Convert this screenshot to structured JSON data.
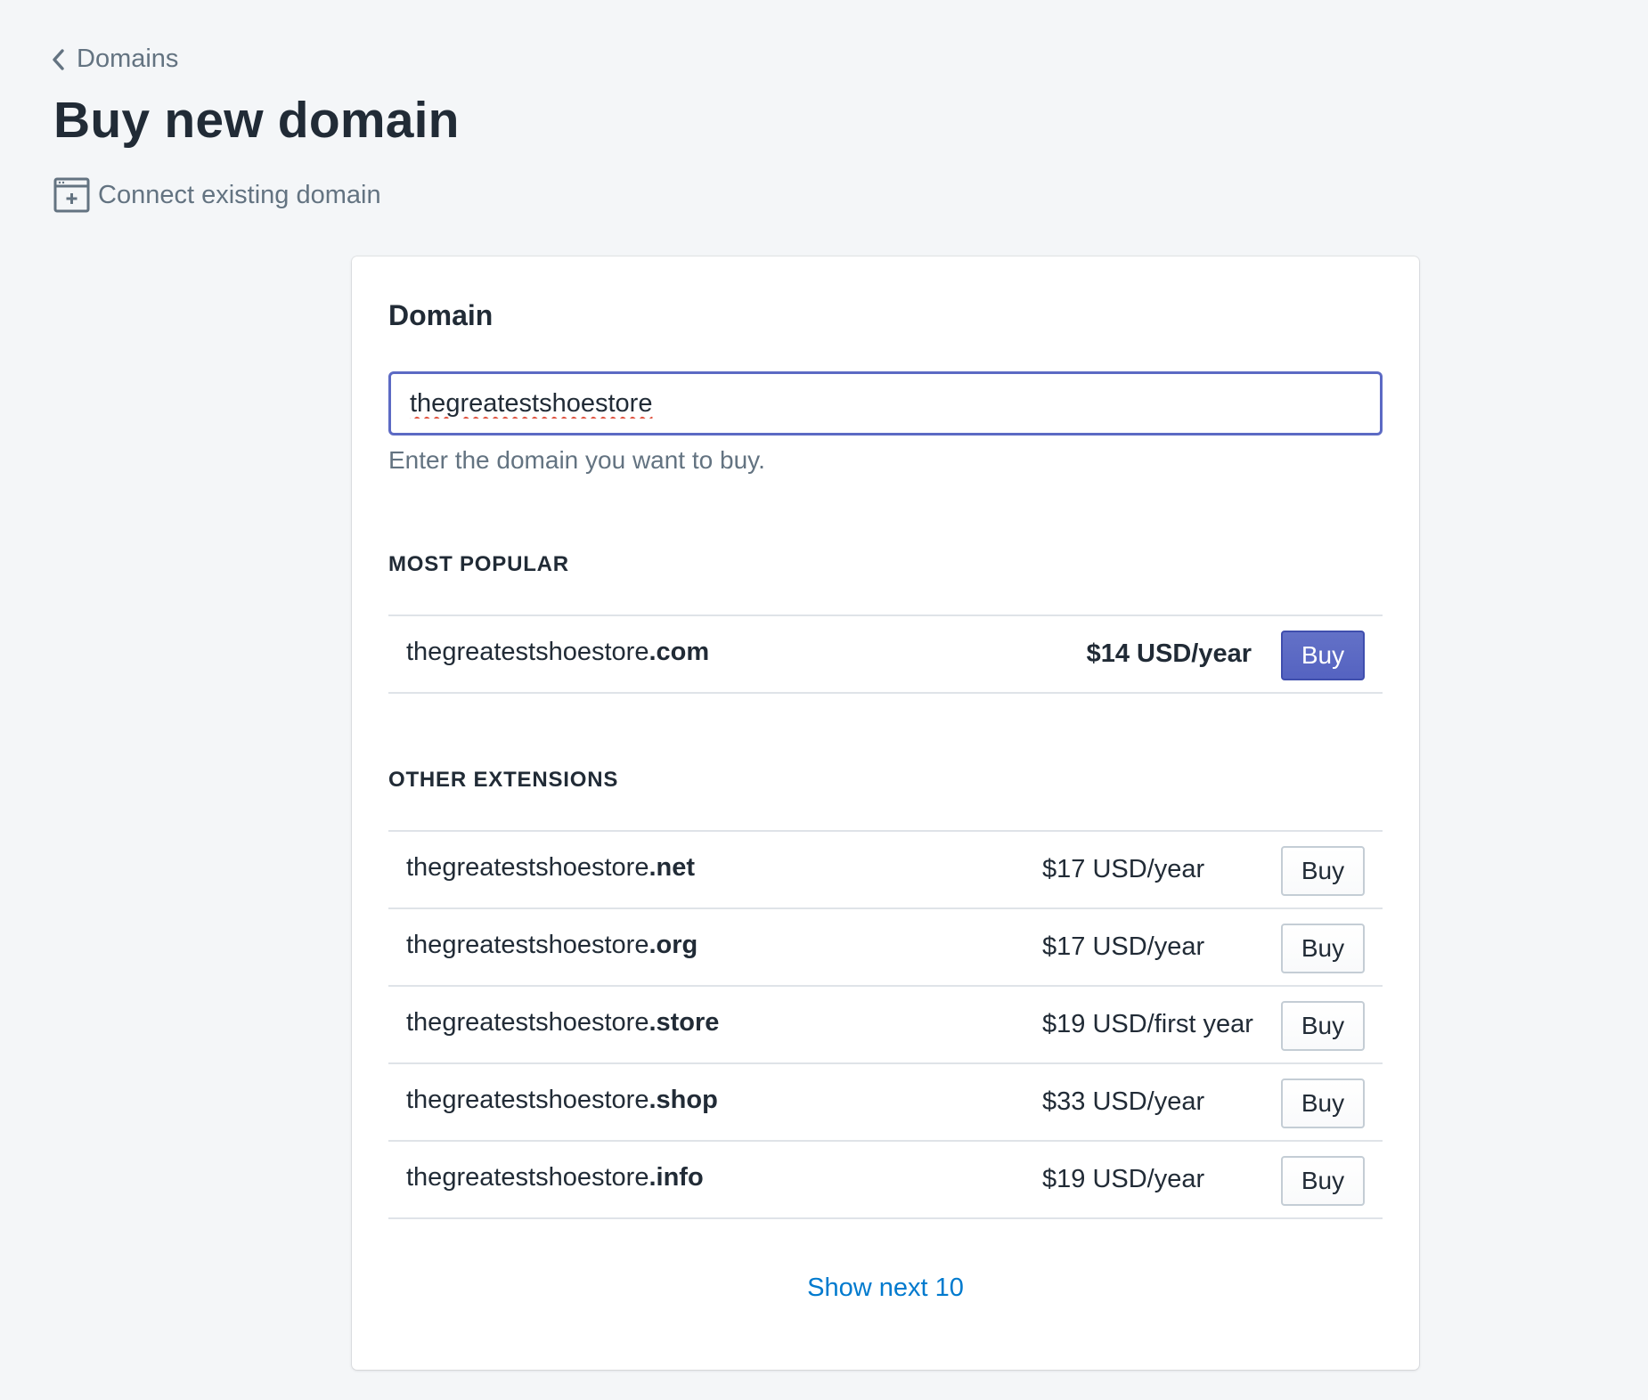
{
  "breadcrumb": {
    "label": "Domains",
    "icon": "chevron-left-icon"
  },
  "page": {
    "title": "Buy new domain"
  },
  "secondary_action": {
    "label": "Connect existing domain",
    "icon": "browser-plus-icon"
  },
  "card": {
    "heading": "Domain",
    "input_value": "thegreatestshoestore",
    "help_text": "Enter the domain you want to buy."
  },
  "most_popular": {
    "label": "MOST POPULAR",
    "items": [
      {
        "base": "thegreatestshoestore",
        "ext": ".com",
        "price": "$14 USD/year",
        "buy_label": "Buy"
      }
    ]
  },
  "other_extensions": {
    "label": "OTHER EXTENSIONS",
    "items": [
      {
        "base": "thegreatestshoestore",
        "ext": ".net",
        "price": "$17 USD/year",
        "buy_label": "Buy"
      },
      {
        "base": "thegreatestshoestore",
        "ext": ".org",
        "price": "$17 USD/year",
        "buy_label": "Buy"
      },
      {
        "base": "thegreatestshoestore",
        "ext": ".store",
        "price": "$19 USD/first year",
        "buy_label": "Buy"
      },
      {
        "base": "thegreatestshoestore",
        "ext": ".shop",
        "price": "$33 USD/year",
        "buy_label": "Buy"
      },
      {
        "base": "thegreatestshoestore",
        "ext": ".info",
        "price": "$19 USD/year",
        "buy_label": "Buy"
      }
    ]
  },
  "show_next": {
    "label": "Show next 10"
  },
  "colors": {
    "accent": "#5c6ac4",
    "link": "#007ace",
    "background": "#f4f6f8",
    "text": "#212b36",
    "subdued": "#637381"
  }
}
